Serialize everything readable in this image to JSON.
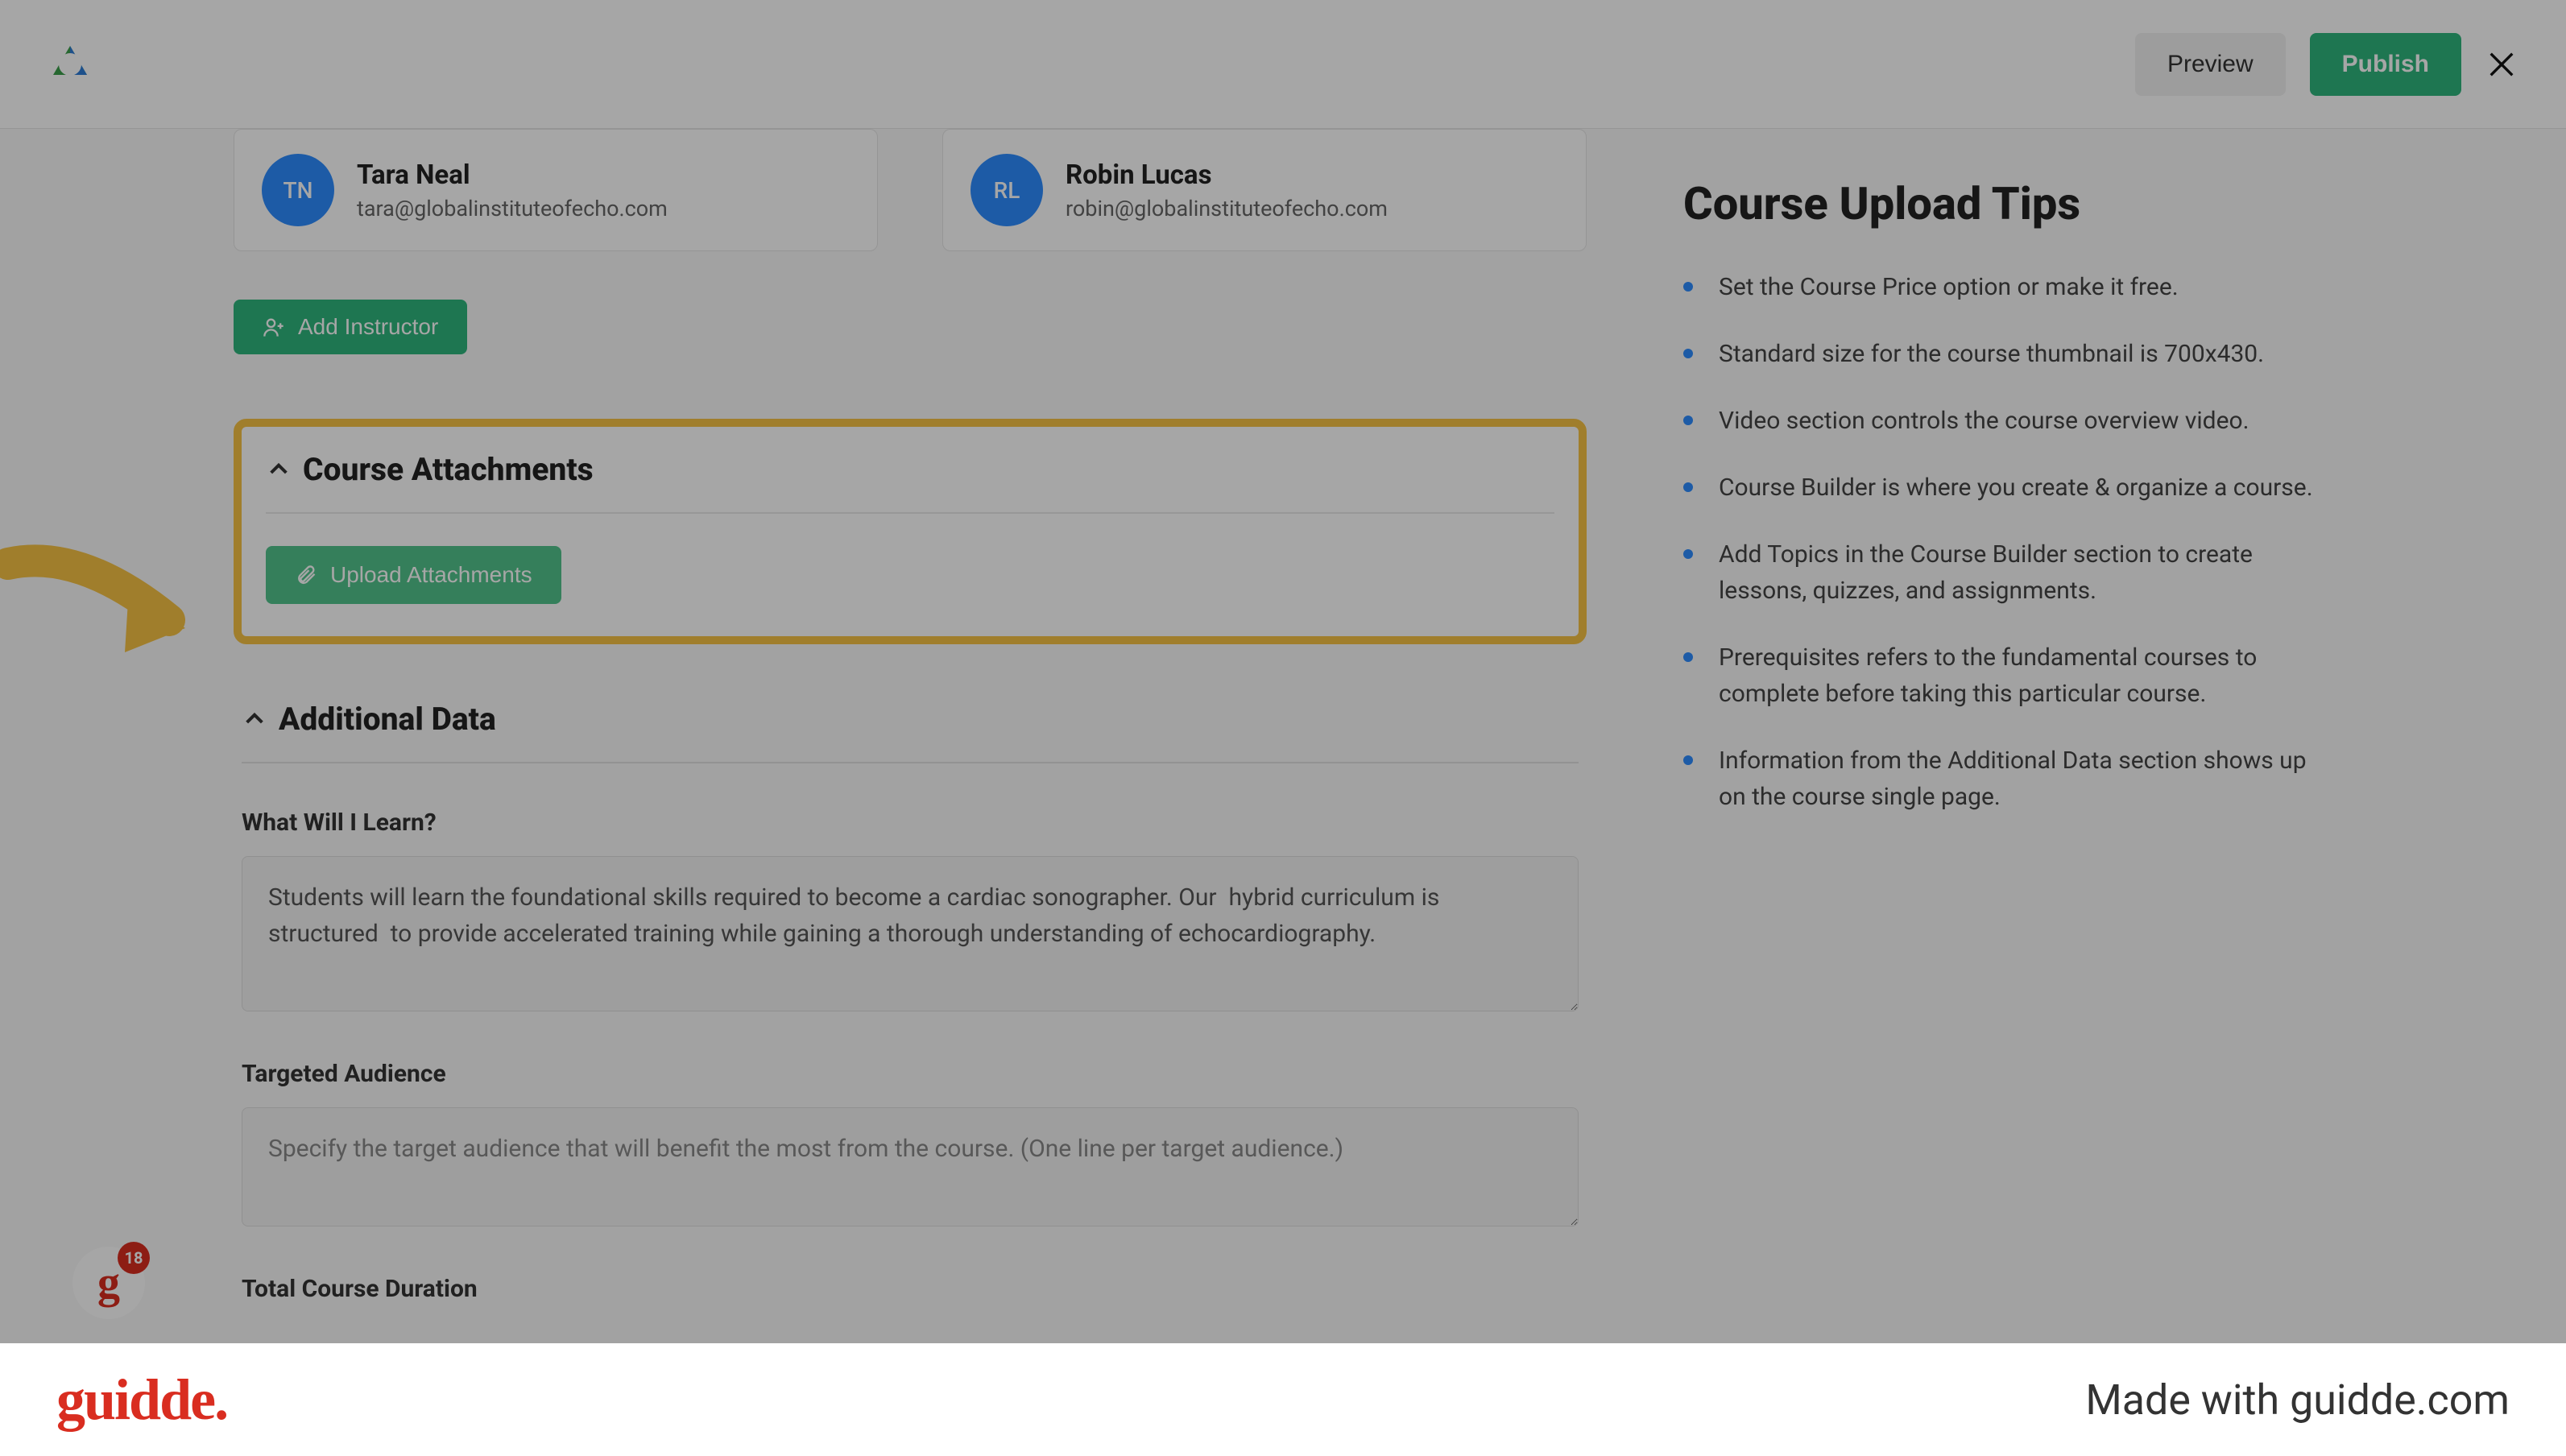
{
  "topbar": {
    "preview_label": "Preview",
    "publish_label": "Publish"
  },
  "instructors": [
    {
      "initials": "TN",
      "name": "Tara Neal",
      "email": "tara@globalinstituteofecho.com"
    },
    {
      "initials": "RL",
      "name": "Robin Lucas",
      "email": "robin@globalinstituteofecho.com"
    }
  ],
  "add_instructor_label": "Add Instructor",
  "attachments_section": {
    "title": "Course Attachments",
    "upload_btn_label": "Upload Attachments"
  },
  "additional_section": {
    "title": "Additional Data",
    "learn_label": "What Will I Learn?",
    "learn_value": "Students will learn the foundational skills required to become a cardiac sonographer. Our  hybrid curriculum is structured  to provide accelerated training while gaining a thorough understanding of echocardiography.",
    "audience_label": "Targeted Audience",
    "audience_placeholder": "Specify the target audience that will benefit the most from the course. (One line per target audience.)",
    "duration_label": "Total Course Duration"
  },
  "tips": {
    "title": "Course Upload Tips",
    "items": [
      "Set the Course Price option or make it free.",
      "Standard size for the course thumbnail is 700x430.",
      "Video section controls the course overview video.",
      "Course Builder is where you create & organize a course.",
      "Add Topics in the Course Builder section to create lessons, quizzes, and assignments.",
      "Prerequisites refers to the fundamental courses to complete before taking this particular course.",
      "Information from the Additional Data section shows up on the course single page."
    ]
  },
  "notification_count": "18",
  "footer": {
    "logo_text": "guidde.",
    "made_with": "Made with guidde.com"
  }
}
